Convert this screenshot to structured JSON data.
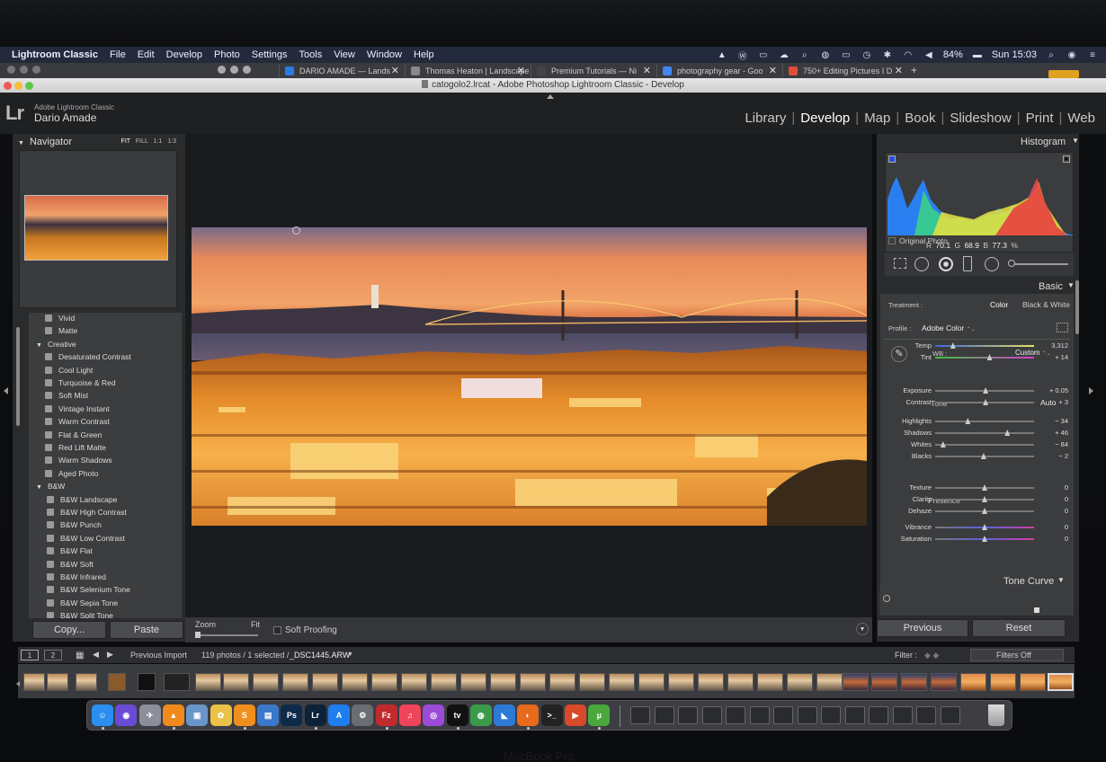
{
  "menubar": {
    "app_name": "Lightroom Classic",
    "items": [
      "File",
      "Edit",
      "Develop",
      "Photo",
      "Settings",
      "Tools",
      "View",
      "Window",
      "Help"
    ],
    "battery": "84%",
    "clock": "Sun 15:03"
  },
  "browser_tabs": [
    {
      "label": "DARIO AMADE — Lands",
      "favicon_color": "#2a7be4"
    },
    {
      "label": "Thomas Heaton | Landscape",
      "favicon_color": "#888888"
    },
    {
      "label": "Premium Tutorials — Ni",
      "favicon_color": "#444444"
    },
    {
      "label": "photography gear - Goo",
      "favicon_color": "#4285f4"
    },
    {
      "label": "750+ Editing Pictures I D",
      "favicon_color": "#e04e3a"
    }
  ],
  "window": {
    "title": "catogolo2.lrcat - Adobe Photoshop Lightroom Classic - Develop"
  },
  "lr_header": {
    "logo": "Lr",
    "product": "Adobe Lightroom Classic",
    "user": "Dario Amade",
    "modules": [
      "Library",
      "Develop",
      "Map",
      "Book",
      "Slideshow",
      "Print",
      "Web"
    ],
    "active_module": "Develop"
  },
  "navigator": {
    "title": "Navigator",
    "options": [
      "FIT",
      "FILL",
      "1:1",
      "1:3"
    ]
  },
  "presets": [
    {
      "label": "Vivid",
      "type": "preset"
    },
    {
      "label": "Matte",
      "type": "preset"
    },
    {
      "label": "Creative",
      "type": "group"
    },
    {
      "label": "Desaturated Contrast",
      "type": "preset"
    },
    {
      "label": "Cool Light",
      "type": "preset"
    },
    {
      "label": "Turquoise & Red",
      "type": "preset"
    },
    {
      "label": "Soft Mist",
      "type": "preset"
    },
    {
      "label": "Vintage Instant",
      "type": "preset"
    },
    {
      "label": "Warm Contrast",
      "type": "preset"
    },
    {
      "label": "Flat & Green",
      "type": "preset"
    },
    {
      "label": "Red Lift Matte",
      "type": "preset"
    },
    {
      "label": "Warm Shadows",
      "type": "preset"
    },
    {
      "label": "Aged Photo",
      "type": "preset"
    },
    {
      "label": "B&W",
      "type": "group"
    },
    {
      "label": "B&W Landscape",
      "type": "preset"
    },
    {
      "label": "B&W High Contrast",
      "type": "preset"
    },
    {
      "label": "B&W Punch",
      "type": "preset"
    },
    {
      "label": "B&W Low Contrast",
      "type": "preset"
    },
    {
      "label": "B&W Flat",
      "type": "preset"
    },
    {
      "label": "B&W Soft",
      "type": "preset"
    },
    {
      "label": "B&W Infrared",
      "type": "preset"
    },
    {
      "label": "B&W Selenium Tone",
      "type": "preset"
    },
    {
      "label": "B&W Sepia Tone",
      "type": "preset"
    },
    {
      "label": "B&W Split Tone",
      "type": "preset"
    }
  ],
  "left_buttons": {
    "copy": "Copy...",
    "paste": "Paste"
  },
  "toolbar": {
    "zoom": "Zoom",
    "fit": "Fit",
    "soft_proofing": "Soft Proofing"
  },
  "histogram": {
    "title": "Histogram",
    "r_label": "R",
    "r": "70.1",
    "g_label": "G",
    "g": "68.9",
    "b_label": "B",
    "b": "77.3",
    "unit": "%",
    "original_photo": "Original Photo"
  },
  "basic": {
    "title": "Basic",
    "treatment_label": "Treatment :",
    "treatment_color": "Color",
    "treatment_bw": "Black & White",
    "profile_label": "Profile :",
    "profile_value": "Adobe Color",
    "wb_label": "WB :",
    "wb_value": "Custom",
    "tone_label": "Tone",
    "auto_label": "Auto",
    "presence_label": "Presence",
    "sliders": [
      {
        "label": "Temp",
        "value": "3,312",
        "level": 0.18
      },
      {
        "label": "Tint",
        "value": "+ 14",
        "level": 0.55
      },
      {
        "label": "Exposure",
        "value": "+ 0.05",
        "level": 0.51
      },
      {
        "label": "Contrast",
        "value": "+ 3",
        "level": 0.51
      },
      {
        "label": "Highlights",
        "value": "− 34",
        "level": 0.33
      },
      {
        "label": "Shadows",
        "value": "+ 46",
        "level": 0.73
      },
      {
        "label": "Whites",
        "value": "− 84",
        "level": 0.08
      },
      {
        "label": "Blacks",
        "value": "− 2",
        "level": 0.49
      },
      {
        "label": "Texture",
        "value": "0",
        "level": 0.5
      },
      {
        "label": "Clarity",
        "value": "0",
        "level": 0.5
      },
      {
        "label": "Dehaze",
        "value": "0",
        "level": 0.5
      },
      {
        "label": "Vibrance",
        "value": "0",
        "level": 0.5
      },
      {
        "label": "Saturation",
        "value": "0",
        "level": 0.5
      }
    ]
  },
  "tone_curve": {
    "title": "Tone Curve"
  },
  "right_buttons": {
    "previous": "Previous",
    "reset": "Reset"
  },
  "filmbar": {
    "view1": "1",
    "view2": "2",
    "source": "Previous Import",
    "count": "119 photos / 1 selected /",
    "filename": "_DSC1445.ARW",
    "filter_label": "Filter :",
    "filter_value": "Filters Off"
  },
  "dock_apps": [
    {
      "name": "finder-icon",
      "glyph": "☺",
      "color": "#2b8ef0"
    },
    {
      "name": "siri-icon",
      "glyph": "◉",
      "color": "#6a4bd6"
    },
    {
      "name": "launchpad-icon",
      "glyph": "✈",
      "color": "#8a8f99"
    },
    {
      "name": "vlc-icon",
      "glyph": "▲",
      "color": "#f08a1c"
    },
    {
      "name": "preview-icon",
      "glyph": "▣",
      "color": "#6a95c9"
    },
    {
      "name": "photos-icon",
      "glyph": "✿",
      "color": "#e9c246"
    },
    {
      "name": "sublime-icon",
      "glyph": "S",
      "color": "#f08f1e"
    },
    {
      "name": "notes-icon",
      "glyph": "▤",
      "color": "#3a78c9"
    },
    {
      "name": "photoshop-icon",
      "glyph": "Ps",
      "color": "#0d2a4a"
    },
    {
      "name": "lightroom-icon",
      "glyph": "Lr",
      "color": "#0c2238"
    },
    {
      "name": "appstore-icon",
      "glyph": "A",
      "color": "#1e7ef0"
    },
    {
      "name": "preferences-icon",
      "glyph": "⚙",
      "color": "#6a6d72"
    },
    {
      "name": "filezilla-icon",
      "glyph": "Fz",
      "color": "#c22b2b"
    },
    {
      "name": "music-icon",
      "glyph": "♫",
      "color": "#f0445a"
    },
    {
      "name": "podcasts-icon",
      "glyph": "◎",
      "color": "#9b4bd8"
    },
    {
      "name": "appletv-icon",
      "glyph": "tv",
      "color": "#111111"
    },
    {
      "name": "chrome-icon",
      "glyph": "◍",
      "color": "#3a9a4a"
    },
    {
      "name": "vscode-icon",
      "glyph": "◣",
      "color": "#2d7ad6"
    },
    {
      "name": "firefox-icon",
      "glyph": "◐",
      "color": "#e86a1c"
    },
    {
      "name": "terminal-icon",
      "glyph": ">_",
      "color": "#222222"
    },
    {
      "name": "screenflow-icon",
      "glyph": "▶",
      "color": "#d84a2a"
    },
    {
      "name": "utorrent-icon",
      "glyph": "µ",
      "color": "#4aa83a"
    }
  ],
  "macbook_label": "MacBook Pro"
}
